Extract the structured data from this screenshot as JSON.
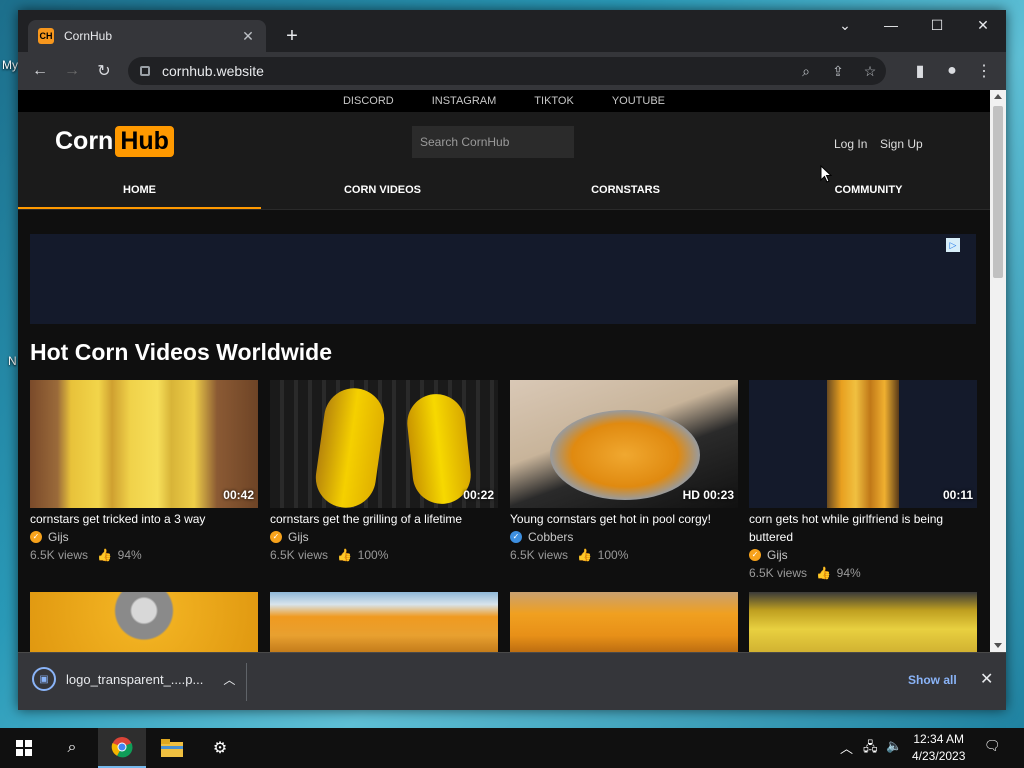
{
  "desktop": {
    "labels": [
      "My",
      "N"
    ]
  },
  "browser": {
    "tab_title": "CornHub",
    "favicon_text": "CH",
    "url": "cornhub.website",
    "new_tab": "+"
  },
  "site": {
    "social": [
      "DISCORD",
      "INSTAGRAM",
      "TIKTOK",
      "YOUTUBE"
    ],
    "logo_left": "Corn",
    "logo_right": "Hub",
    "search_placeholder": "Search CornHub",
    "login": "Log In",
    "signup": "Sign Up",
    "nav": [
      "HOME",
      "CORN VIDEOS",
      "CORNSTARS",
      "COMMUNITY"
    ],
    "section_title": "Hot Corn Videos Worldwide",
    "videos": [
      {
        "title": "cornstars get tricked into a 3 way",
        "author": "Gijs",
        "verified_color": "#f7a21b",
        "views": "6.5K views",
        "rating": "94%",
        "duration": "00:42"
      },
      {
        "title": "cornstars get the grilling of a lifetime",
        "author": "Gijs",
        "verified_color": "#f7a21b",
        "views": "6.5K views",
        "rating": "100%",
        "duration": "00:22"
      },
      {
        "title": "Young cornstars get hot in pool corgy!",
        "author": "Cobbers",
        "verified_color": "#3d8fe0",
        "views": "6.5K views",
        "rating": "100%",
        "duration": "HD 00:23"
      },
      {
        "title": "corn gets hot while girlfriend is being buttered",
        "author": "Gijs",
        "verified_color": "#f7a21b",
        "views": "6.5K views",
        "rating": "94%",
        "duration": "00:11"
      }
    ]
  },
  "downloads": {
    "file": "logo_transparent_....p...",
    "show_all": "Show all"
  },
  "taskbar": {
    "time": "12:34 AM",
    "date": "4/23/2023"
  },
  "colors": {
    "accent": "#ff9900",
    "page_bg": "#0f0f0f",
    "ad_bg": "#141a2b"
  }
}
